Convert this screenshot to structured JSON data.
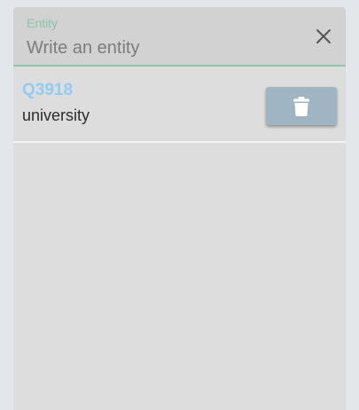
{
  "entity_field": {
    "label": "Entity",
    "placeholder": "Write an entity",
    "value": "",
    "clear_icon": "close-icon"
  },
  "results": [
    {
      "id": "Q3918",
      "description": "university",
      "action_icon": "trash-icon"
    }
  ],
  "colors": {
    "accent": "#8ec5ae",
    "link": "#90ccf4",
    "delete_button": "#9fb5c4"
  }
}
